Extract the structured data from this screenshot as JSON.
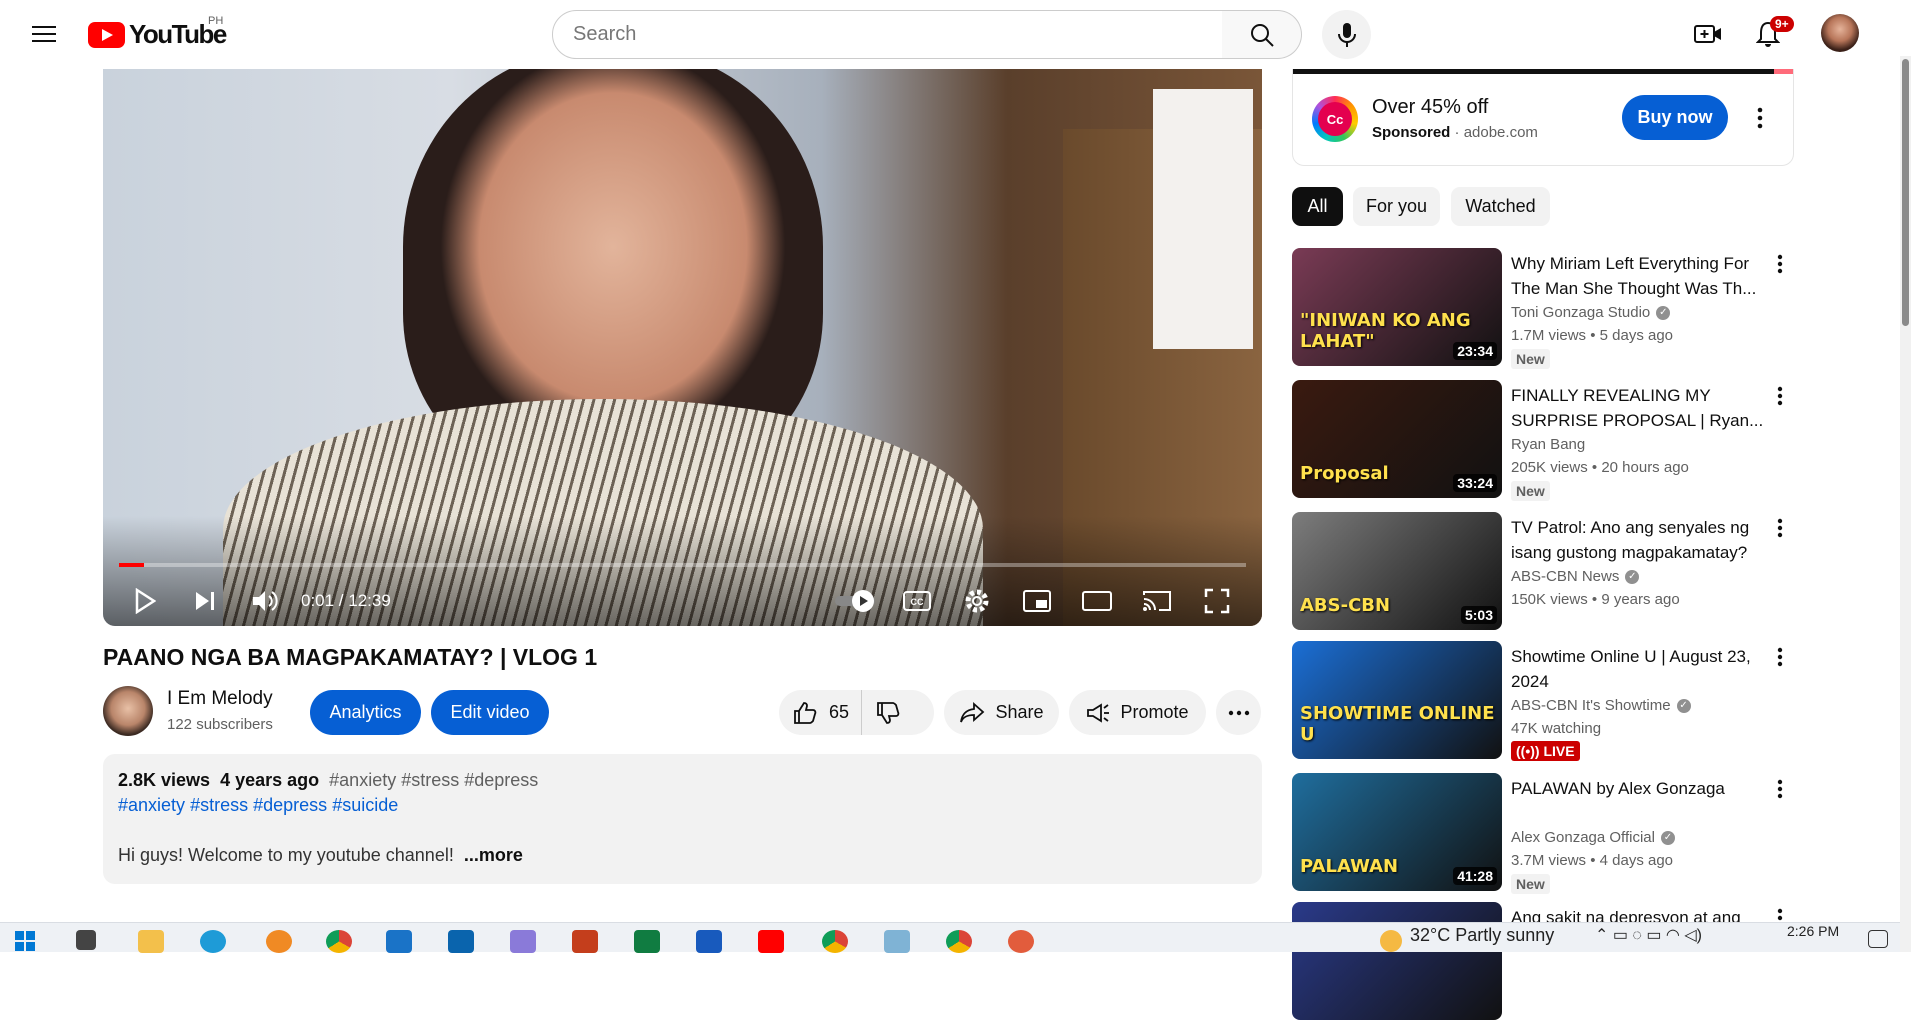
{
  "header": {
    "logo_text": "YouTube",
    "country_code": "PH",
    "search_placeholder": "Search",
    "notification_count": "9+"
  },
  "player": {
    "current_time": "0:01 / 12:39",
    "progress_fraction": 0.0013
  },
  "video": {
    "title": "PAANO NGA BA MAGPAKAMATAY? | VLOG 1",
    "channel_name": "I Em Melody",
    "subscribers": "122 subscribers",
    "analytics_label": "Analytics",
    "edit_label": "Edit video",
    "likes": "65",
    "share_label": "Share",
    "promote_label": "Promote"
  },
  "description": {
    "views": "2.8K views",
    "age": "4 years ago",
    "tags_inline": "#anxiety #stress #depress",
    "hashtags": [
      "#anxiety",
      "#stress",
      "#depress",
      "#suicide"
    ],
    "text": "Hi guys! Welcome to my youtube channel!",
    "more_label": "...more"
  },
  "ad": {
    "title": "Over 45% off",
    "sponsored_label": "Sponsored",
    "domain": "adobe.com",
    "cta": "Buy now"
  },
  "chips": [
    "All",
    "For you",
    "Watched"
  ],
  "recommendations": [
    {
      "title": "Why Miriam Left Everything For The Man She Thought Was Th...",
      "channel": "Toni Gonzaga Studio",
      "verified": true,
      "views": "1.7M views",
      "age": "5 days ago",
      "badge": "New",
      "duration": "23:34",
      "thumb_text": "\"INIWAN KO ANG LAHAT\"",
      "thumb_color": "#7a3b55"
    },
    {
      "title": "FINALLY REVEALING MY SURPRISE PROPOSAL | Ryan...",
      "channel": "Ryan Bang",
      "verified": false,
      "views": "205K views",
      "age": "20 hours ago",
      "badge": "New",
      "duration": "33:24",
      "thumb_text": "Proposal",
      "thumb_color": "#3a1a10"
    },
    {
      "title": "TV Patrol: Ano ang senyales ng isang gustong magpakamatay?",
      "channel": "ABS-CBN News",
      "verified": true,
      "views": "150K views",
      "age": "9 years ago",
      "badge": "",
      "duration": "5:03",
      "thumb_text": "ABS-CBN",
      "thumb_color": "#7d7d7d"
    },
    {
      "title": "Showtime Online U | August 23, 2024",
      "channel": "ABS-CBN It's Showtime",
      "verified": true,
      "views": "47K watching",
      "age": "",
      "badge": "LIVE",
      "duration": "",
      "thumb_text": "SHOWTIME ONLINE U",
      "thumb_color": "#1b6fd6"
    },
    {
      "title": "PALAWAN by Alex Gonzaga",
      "channel": "Alex Gonzaga Official",
      "verified": true,
      "views": "3.7M views",
      "age": "4 days ago",
      "badge": "New",
      "duration": "41:28",
      "thumb_text": "PALAWAN",
      "thumb_color": "#1f6e9e"
    },
    {
      "title": "Ang sakit na depresyon at ang",
      "channel": "",
      "verified": false,
      "views": "",
      "age": "",
      "badge": "",
      "duration": "",
      "thumb_text": "",
      "thumb_color": "#2a3a8a"
    }
  ],
  "taskbar": {
    "weather": "32°C  Partly sunny",
    "time": "2:26 PM"
  }
}
